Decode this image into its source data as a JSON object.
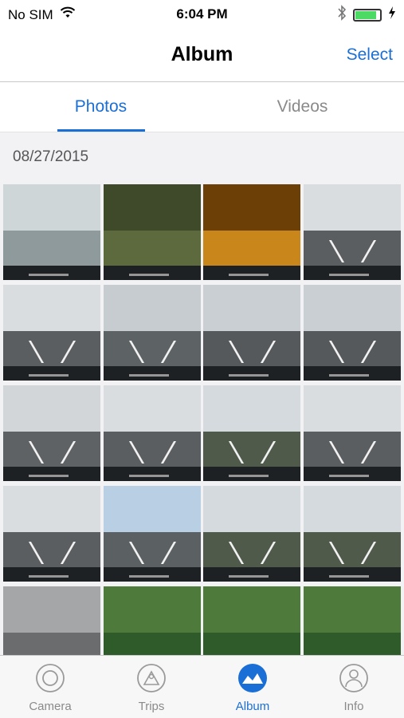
{
  "status_bar": {
    "carrier": "No SIM",
    "time": "6:04 PM",
    "battery_level": 0.85,
    "battery_color": "#4cd964"
  },
  "nav": {
    "title": "Album",
    "select_label": "Select"
  },
  "segments": [
    {
      "label": "Photos",
      "active": true
    },
    {
      "label": "Videos",
      "active": false
    }
  ],
  "section": {
    "date": "08/27/2015"
  },
  "thumbnails": [
    {
      "kind": "parking"
    },
    {
      "kind": "tunnel-green"
    },
    {
      "kind": "tunnel-orange"
    },
    {
      "kind": "highway"
    },
    {
      "kind": "highway"
    },
    {
      "kind": "bridge"
    },
    {
      "kind": "highway-hill"
    },
    {
      "kind": "highway-hill"
    },
    {
      "kind": "highway-truck"
    },
    {
      "kind": "highway"
    },
    {
      "kind": "highway-trees"
    },
    {
      "kind": "highway"
    },
    {
      "kind": "highway"
    },
    {
      "kind": "highway-building"
    },
    {
      "kind": "highway-trees"
    },
    {
      "kind": "highway-trees"
    },
    {
      "kind": "car-interior"
    },
    {
      "kind": "trees"
    },
    {
      "kind": "trees"
    },
    {
      "kind": "trees"
    }
  ],
  "tabs": [
    {
      "label": "Camera",
      "icon": "camera-icon",
      "active": false
    },
    {
      "label": "Trips",
      "icon": "trips-icon",
      "active": false
    },
    {
      "label": "Album",
      "icon": "album-icon",
      "active": true
    },
    {
      "label": "Info",
      "icon": "info-icon",
      "active": false
    }
  ],
  "colors": {
    "accent": "#1a6fd6",
    "inactive": "#8a8a8a"
  }
}
